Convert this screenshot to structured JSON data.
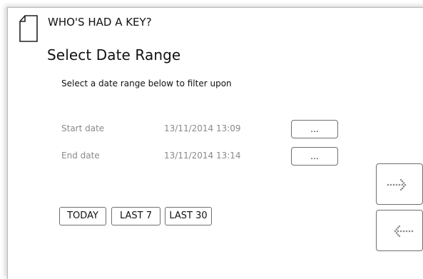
{
  "header": {
    "title": "WHO'S HAD A KEY?",
    "doc_icon": "document-icon"
  },
  "page": {
    "title": "Select Date Range",
    "instruction": "Select a date range below to filter upon"
  },
  "fields": [
    {
      "label": "Start date",
      "value": "13/11/2014 13:09",
      "button_label": "..."
    },
    {
      "label": "End date",
      "value": "13/11/2014 13:14",
      "button_label": "..."
    }
  ],
  "quick_ranges": [
    {
      "label": "TODAY"
    },
    {
      "label": "LAST 7"
    },
    {
      "label": "LAST 30"
    }
  ],
  "navigation": {
    "next_icon": "dotted-arrow-right-icon",
    "back_icon": "dotted-arrow-left-icon"
  },
  "colors": {
    "text": "#111111",
    "muted_text": "#8a8a8a",
    "border": "#6f6f6f",
    "arrow": "#8c8c8c"
  }
}
